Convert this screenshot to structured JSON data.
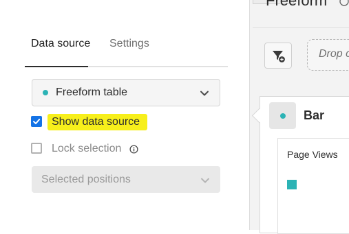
{
  "panel": {
    "tabs": [
      {
        "label": "Data source",
        "active": true
      },
      {
        "label": "Settings",
        "active": false
      }
    ],
    "data_source_dropdown": {
      "selected": "Freeform table",
      "dot_color": "#2bb3b5",
      "icon": "chevron-down-icon"
    },
    "show_data_source": {
      "label": "Show data source",
      "checked": true,
      "highlight_color": "#f7ef1b",
      "check_color": "#1473e6"
    },
    "lock_selection": {
      "label": "Lock selection",
      "checked": false,
      "disabled": true,
      "icon": "info-icon"
    },
    "positions_dropdown": {
      "placeholder": "Selected positions",
      "disabled": true,
      "icon": "chevron-down-icon"
    }
  },
  "workspace": {
    "title": "Freeform",
    "filter_button_icon": "filter-add-icon",
    "drop_zone_label": "Drop c",
    "visualization": {
      "title": "Bar",
      "dot_color": "#2bb3b5",
      "legend_title": "Page Views",
      "legend_color": "#2bb3b5"
    }
  }
}
